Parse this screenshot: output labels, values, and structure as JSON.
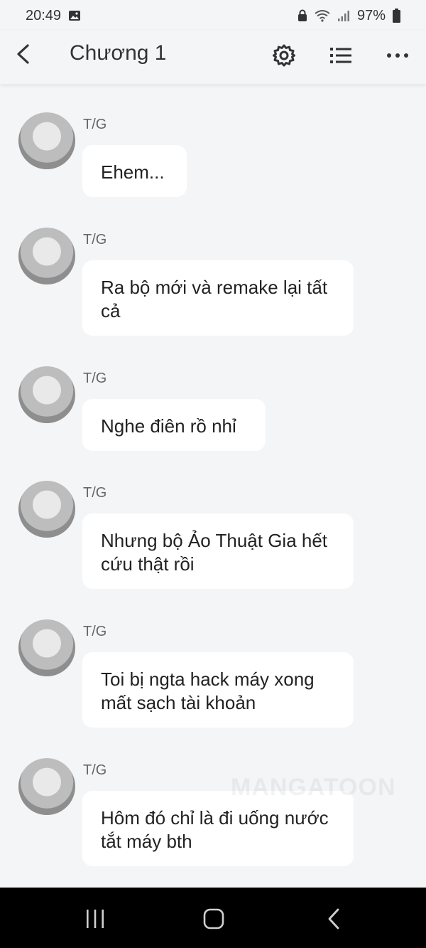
{
  "status_bar": {
    "time": "20:49",
    "battery": "97%",
    "icons": [
      "gallery-icon",
      "lock-icon",
      "wifi-icon",
      "signal-icon",
      "battery-icon"
    ]
  },
  "app_bar": {
    "title": "Chương 1",
    "actions": [
      "back-icon",
      "settings-icon",
      "list-icon",
      "more-icon"
    ]
  },
  "messages": [
    {
      "author": "T/G",
      "text": "Ehem..."
    },
    {
      "author": "T/G",
      "text": "Ra bộ mới và remake lại tất cả"
    },
    {
      "author": "T/G",
      "text": "Nghe điên rồ nhỉ"
    },
    {
      "author": "T/G",
      "text": "Nhưng bộ Ảo Thuật Gia hết cứu thật rồi"
    },
    {
      "author": "T/G",
      "text": "Toi bị ngta hack máy xong mất sạch tài khoản"
    },
    {
      "author": "T/G",
      "text": "Hôm đó chỉ là đi uống nước tắt máy bth"
    }
  ],
  "watermark": "MANGATOON",
  "nav_bar": {
    "icons": [
      "recents-icon",
      "home-icon",
      "back-nav-icon"
    ]
  },
  "colors": {
    "background": "#f4f5f7",
    "bubble": "#ffffff",
    "nav": "#000000",
    "text": "#222222"
  }
}
